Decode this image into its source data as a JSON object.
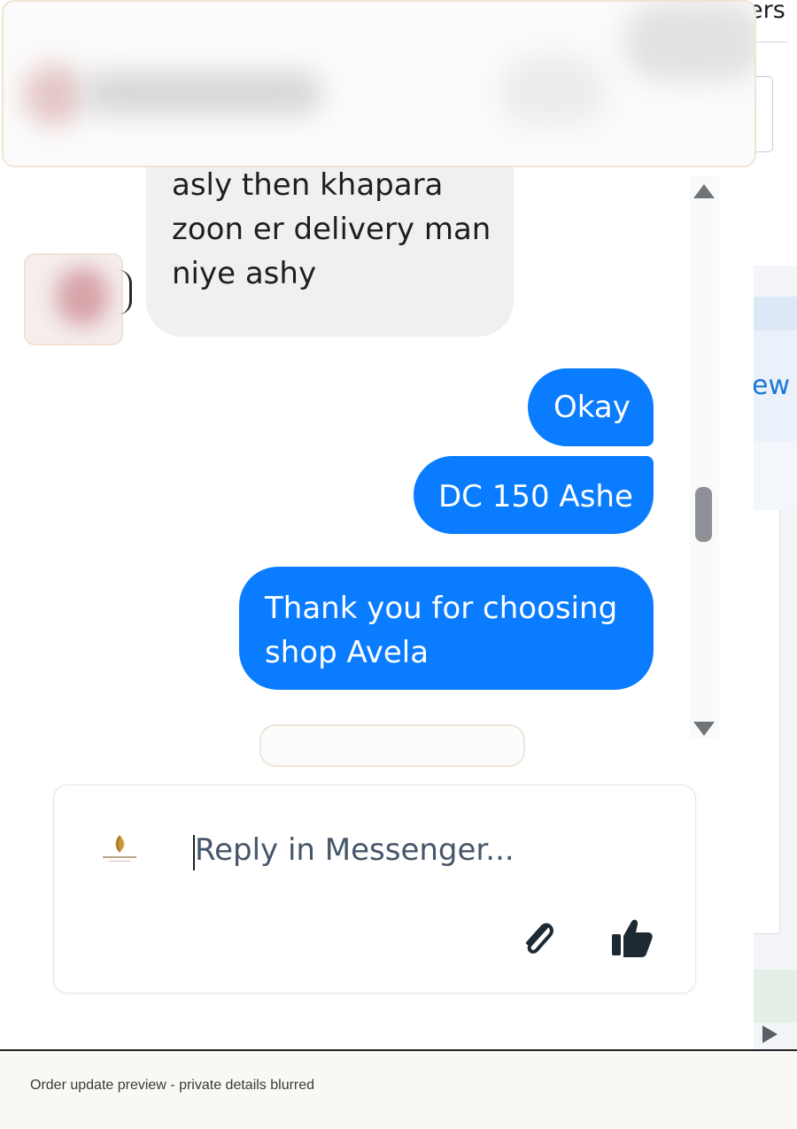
{
  "right_panel": {
    "header_fragment": "ers",
    "link_fragment": "ew"
  },
  "conversation": {
    "incoming": [
      {
        "lines": [
          "asly then khapara",
          "zoon er delivery man",
          "niye ashy"
        ]
      }
    ],
    "outgoing": [
      {
        "lines": [
          "Okay"
        ]
      },
      {
        "lines": [
          "DC 150 Ashe"
        ]
      },
      {
        "lines": [
          "Thank you for choosing",
          "shop Avela"
        ]
      }
    ]
  },
  "composer": {
    "placeholder": "Reply in Messenger...",
    "logo_icon": "shop-avela-logo",
    "attach_icon": "paperclip-icon",
    "like_icon": "thumbs-up-icon"
  },
  "footer": {
    "caption": "Order update preview - private details blurred"
  },
  "colors": {
    "outgoing_bubble": "#0a7cff",
    "incoming_bubble": "#f0f0f0"
  }
}
